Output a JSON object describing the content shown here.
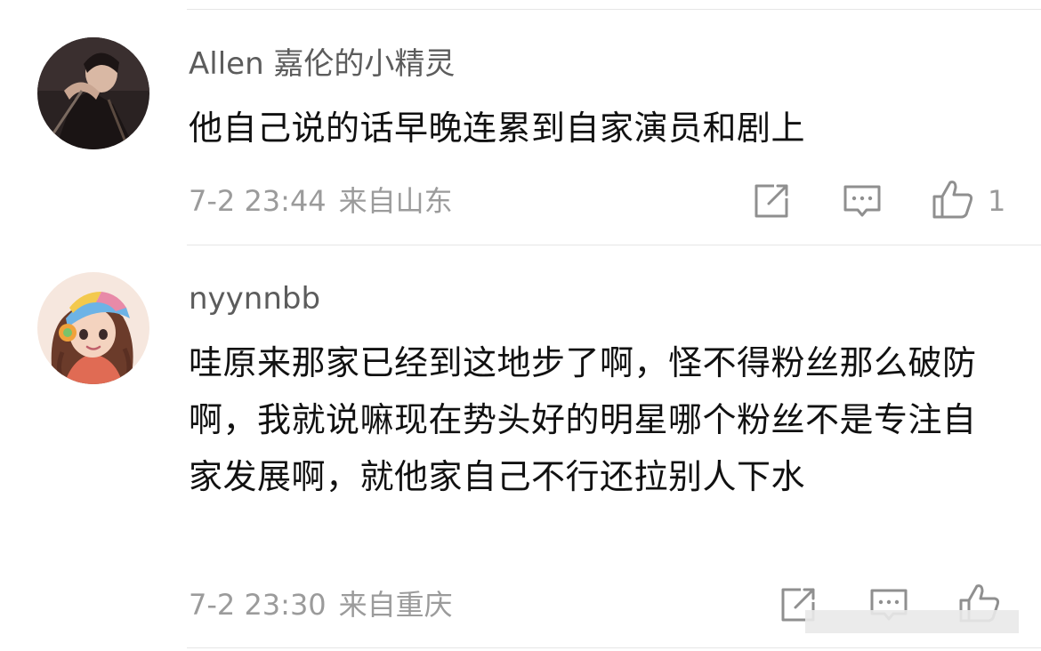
{
  "comments": [
    {
      "username": "Allen 嘉伦的小精灵",
      "text": "他自己说的话早晚连累到自家演员和剧上",
      "date": "7-2 23:44",
      "location": "来自山东",
      "like_count": "1",
      "avatar_icon": "male-portrait-avatar"
    },
    {
      "username": "nyynnbb",
      "text": "哇原来那家已经到这地步了啊，怪不得粉丝那么破防啊，我就说嘛现在势头好的明星哪个粉丝不是专注自家发展啊，就他家自己不行还拉别人下水",
      "date": "7-2 23:30",
      "location": "来自重庆",
      "like_count": "",
      "avatar_icon": "cartoon-girl-headphones-avatar"
    }
  ],
  "icons": {
    "share": "share-icon",
    "reply": "comment-icon",
    "like": "thumbs-up-icon"
  },
  "colors": {
    "username": "#5c5c5c",
    "text": "#111111",
    "meta": "#9b9b9b",
    "icon": "#8f8f8f",
    "divider": "#e6e6e6"
  }
}
